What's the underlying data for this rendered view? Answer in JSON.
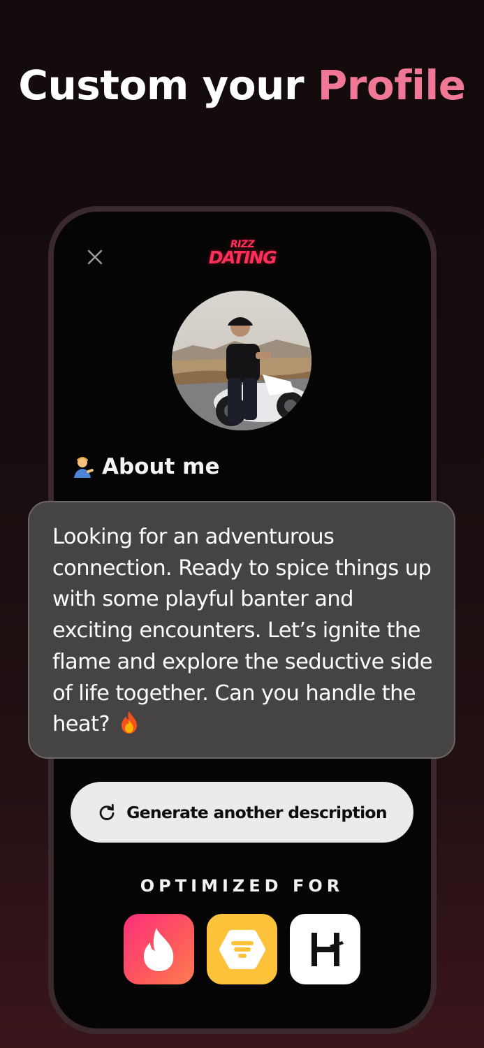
{
  "headline": {
    "prefix": "Custom your",
    "accent": "Profile"
  },
  "logo": {
    "line1": "RIZZ",
    "line2": "DATING"
  },
  "about": {
    "heading": "About me",
    "emoji_icon": "person-tipping-hand-emoji"
  },
  "description": {
    "text": "Looking for an adventurous connection. Ready to spice things up with some playful banter and exciting encounters. Let’s ignite the flame and explore the seductive side of life together. Can you handle the heat?",
    "trailing_icon": "fire-emoji"
  },
  "generate_button": {
    "label": "Generate another description",
    "icon": "refresh-icon"
  },
  "optimized_for": {
    "label": "OPTIMIZED FOR",
    "apps": [
      {
        "name": "Tinder",
        "icon": "tinder-flame-icon"
      },
      {
        "name": "Bumble",
        "icon": "bumble-hex-icon"
      },
      {
        "name": "Hinge",
        "icon": "hinge-h-icon"
      }
    ]
  },
  "colors": {
    "accent_pink": "#f07896",
    "logo_red": "#ff2f5a",
    "card_bg": "#484646",
    "button_bg": "#ebebeb"
  }
}
